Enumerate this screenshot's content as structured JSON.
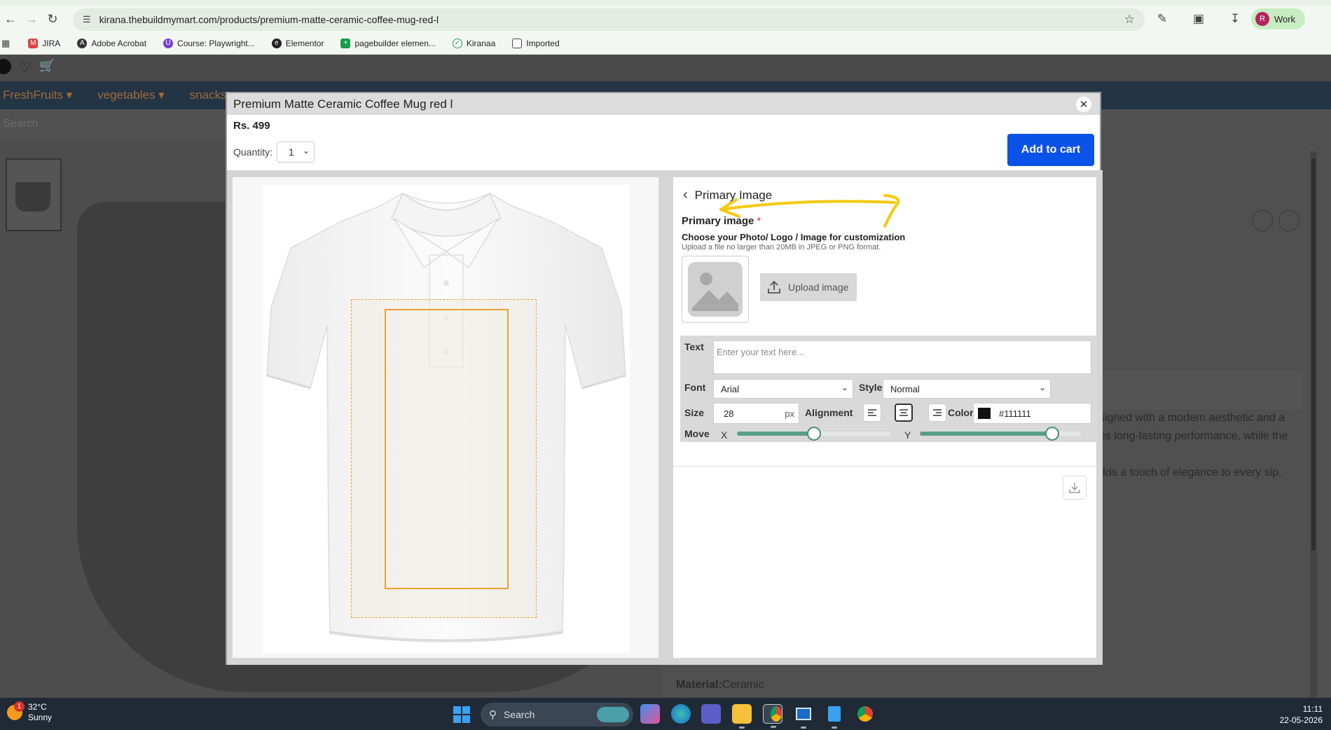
{
  "browser": {
    "url": "kirana.thebuildmymart.com/products/premium-matte-ceramic-coffee-mug-red-l",
    "profile_name": "Work",
    "profile_initial": "R",
    "bookmarks": [
      "JIRA",
      "Adobe Acrobat",
      "Course: Playwright...",
      "Elementor",
      "pagebuilder elemen...",
      "Kiranaa",
      "Imported"
    ]
  },
  "store": {
    "nav": [
      "FreshFruits ▾",
      "vegetables ▾",
      "snacks ▾"
    ],
    "search_placeholder": "Search",
    "description_snippets": [
      "signed with a modern aesthetic and a",
      "es long-lasting performance, while the",
      "dds a touch of elegance to every sip."
    ],
    "material_label": "Material:",
    "material_value": "Ceramic"
  },
  "modal": {
    "title": "Premium Matte Ceramic Coffee Mug red l",
    "price": "Rs. 499",
    "quantity_label": "Quantity:",
    "quantity_value": "1",
    "add_to_cart": "Add to cart"
  },
  "editor": {
    "back_title": "Primary Image",
    "primary_label": "Primary image",
    "required_mark": "*",
    "description": "Choose your Photo/ Logo / Image for customization",
    "hint": "Upload a file no larger than 20MB in JPEG or PNG format.",
    "upload_label": "Upload image",
    "text_label": "Text",
    "text_placeholder": "Enter your text here...",
    "font_label": "Font",
    "font_value": "Arial",
    "style_label": "Style",
    "style_value": "Normal",
    "size_label": "Size",
    "size_value": "28",
    "size_unit": "px",
    "alignment_label": "Alignment",
    "alignment_selected": "center",
    "color_label": "Color",
    "color_value": "#111111",
    "move_label": "Move",
    "x_label": "X",
    "y_label": "Y",
    "move_x_fraction": 0.5,
    "move_y_fraction": 0.82,
    "annotation_color": "#f6c90e",
    "accent_color": "#5a9e88"
  },
  "taskbar": {
    "temperature": "32°C",
    "weather": "Sunny",
    "notification_count": "1",
    "search_label": "Search",
    "time": "11:11",
    "date": "22-05-2026"
  }
}
